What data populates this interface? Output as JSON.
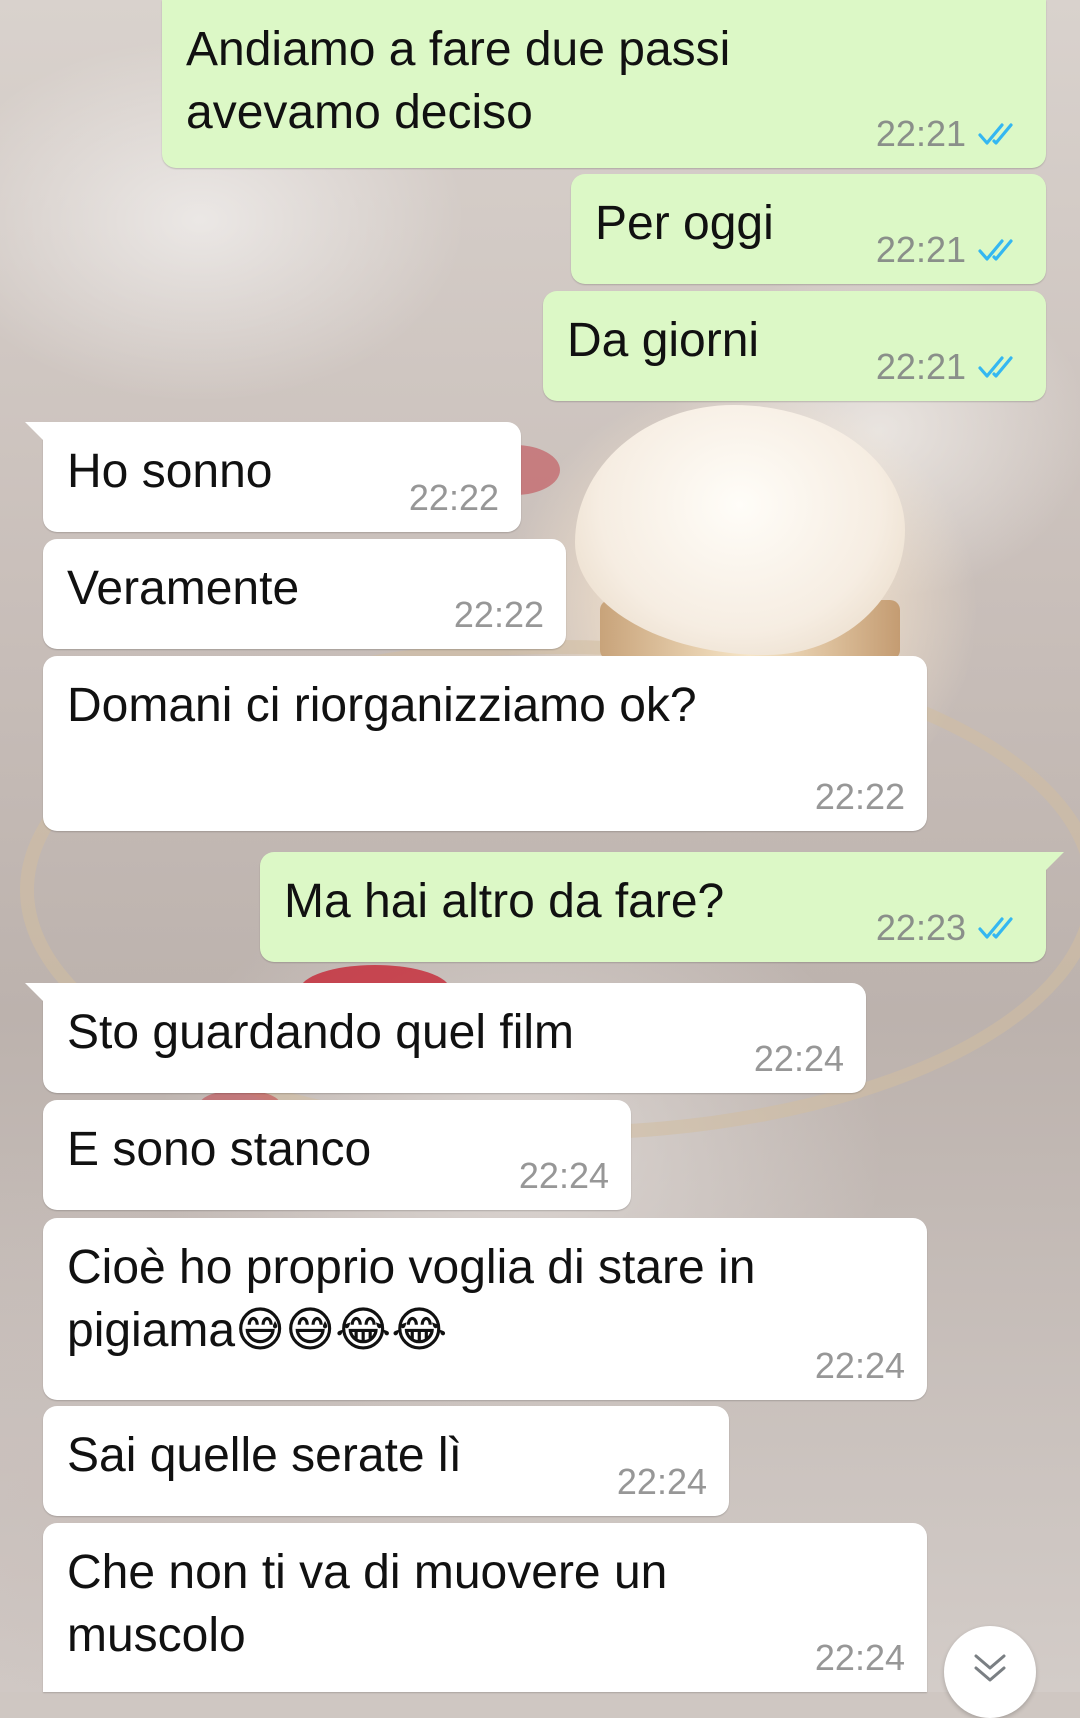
{
  "messages": [
    {
      "direction": "outgoing",
      "text": "Andiamo a fare due passi\navevamo deciso",
      "time": "22:21",
      "status": "read"
    },
    {
      "direction": "outgoing",
      "text": "Per oggi",
      "time": "22:21",
      "status": "read"
    },
    {
      "direction": "outgoing",
      "text": "Da giorni",
      "time": "22:21",
      "status": "read"
    },
    {
      "direction": "incoming",
      "text": "Ho sonno",
      "time": "22:22"
    },
    {
      "direction": "incoming",
      "text": "Veramente",
      "time": "22:22"
    },
    {
      "direction": "incoming",
      "text": "Domani ci riorganizziamo ok?",
      "time": "22:22"
    },
    {
      "direction": "outgoing",
      "text": "Ma hai altro da fare?",
      "time": "22:23",
      "status": "read"
    },
    {
      "direction": "incoming",
      "text": "Sto guardando quel film",
      "time": "22:24"
    },
    {
      "direction": "incoming",
      "text": "E sono stanco",
      "time": "22:24"
    },
    {
      "direction": "incoming",
      "text": "Cioè ho proprio voglia di stare in\npigiama😅😅😂😂",
      "time": "22:24"
    },
    {
      "direction": "incoming",
      "text": "Sai quelle serate lì",
      "time": "22:24"
    },
    {
      "direction": "incoming",
      "text": "Che non ti va di muovere un\nmuscolo",
      "time": "22:24"
    }
  ],
  "colors": {
    "outgoing_bubble": "#dcf8c6",
    "incoming_bubble": "#ffffff",
    "read_ticks": "#34b7f1",
    "timestamp": "#8a8f8a"
  },
  "icons": {
    "read_receipt": "double-check-icon",
    "scroll_down": "double-chevron-down-icon"
  }
}
